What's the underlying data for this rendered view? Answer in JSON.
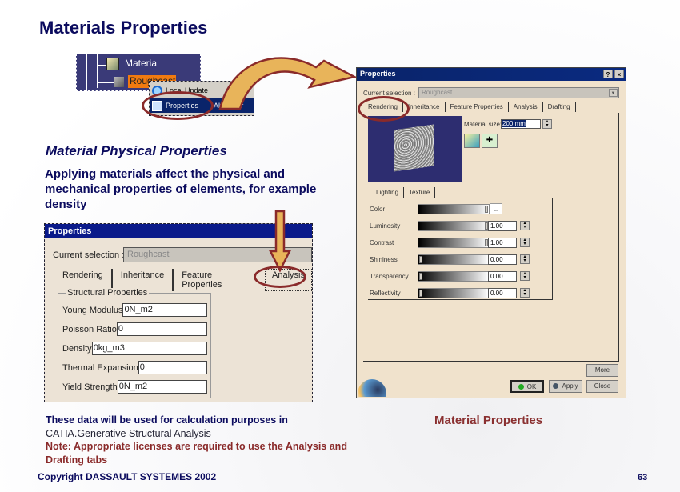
{
  "slide": {
    "title": "Materials Properties",
    "subtitle": "Material Physical Properties",
    "paragraph": "Applying materials affect the physical and mechanical properties of elements, for example density",
    "notes": {
      "line1": "These data will be used for calculation purposes in",
      "line2": "CATIA.Generative Structural Analysis",
      "line3": "Note: Appropriate licenses are required to use the Analysis and Drafting tabs"
    },
    "caption": "Material Properties",
    "copyright": "Copyright DASSAULT SYSTEMES 2002",
    "page_number": "63",
    "colors": {
      "title": "#0b0b5e",
      "accent_red": "#8a2a2a",
      "arrow": "#e8b45a"
    }
  },
  "tree": {
    "items": [
      {
        "label": "Materia",
        "icon": "material-library-icon"
      },
      {
        "label": "Roughcast",
        "icon": "cube-icon",
        "selected": true
      }
    ]
  },
  "context_menu": {
    "items": [
      {
        "label": "Local Update",
        "icon": "update-icon"
      },
      {
        "label": "Properties",
        "accel": "Alt+Enter",
        "icon": "properties-icon",
        "selected": true
      }
    ]
  },
  "right_dialog": {
    "title": "Properties",
    "help_btn": "?",
    "close_btn": "×",
    "current_selection_label": "Current selection :",
    "current_selection_value": "Roughcast",
    "tabs": [
      "Rendering",
      "Inheritance",
      "Feature Properties",
      "Analysis",
      "Drafting"
    ],
    "active_tab": "Rendering",
    "material_size_label": "Material size:",
    "material_size_value": "200 mm",
    "sub_tabs": [
      "Lighting",
      "Texture"
    ],
    "lighting": [
      {
        "label": "Color",
        "slider": 1.0,
        "value": "...",
        "type": "color"
      },
      {
        "label": "Luminosity",
        "slider": 1.0,
        "value": "1.00"
      },
      {
        "label": "Contrast",
        "slider": 1.0,
        "value": "1.00"
      },
      {
        "label": "Shininess",
        "slider": 0.0,
        "value": "0.00"
      },
      {
        "label": "Transparency",
        "slider": 0.0,
        "value": "0.00"
      },
      {
        "label": "Reflectivity",
        "slider": 0.0,
        "value": "0.00"
      }
    ],
    "buttons": {
      "more": "More",
      "ok": "OK",
      "apply": "Apply",
      "close": "Close"
    }
  },
  "left_dialog": {
    "title": "Properties",
    "current_selection_label": "Current selection :",
    "current_selection_value": "Roughcast",
    "tabs": [
      "Rendering",
      "Inheritance",
      "Feature Properties",
      "Analysis"
    ],
    "active_tab": "Analysis",
    "group_title": "Structural Properties",
    "fields": [
      {
        "label": "Young Modulus",
        "value": "0N_m2"
      },
      {
        "label": "Poisson Ratio",
        "value": "0"
      },
      {
        "label": "Density",
        "value": "0kg_m3"
      },
      {
        "label": "Thermal Expansion",
        "value": "0"
      },
      {
        "label": "Yield Strength",
        "value": "0N_m2"
      }
    ]
  }
}
